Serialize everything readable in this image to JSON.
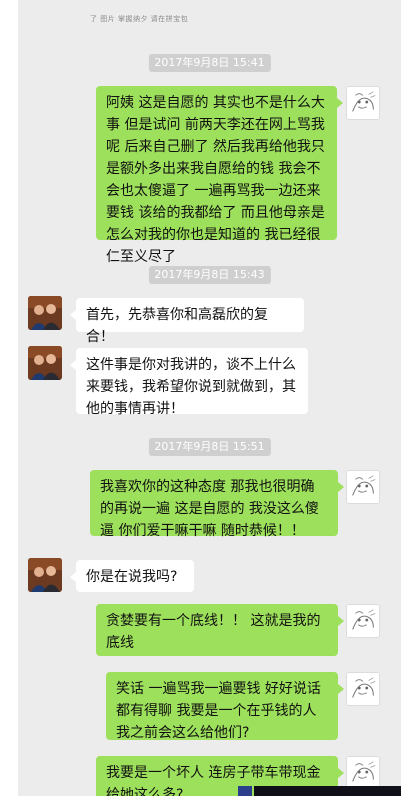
{
  "topbar": {
    "text": "了 图片 掌握纳夕 请在拼宝包"
  },
  "messages": [
    {
      "kind": "time",
      "text": "2017年9月8日 15:41"
    },
    {
      "kind": "msg",
      "side": "self",
      "text": "阿姨 这是自愿的 其实也不是什么大事 但是试问 前两天李还在网上骂我呢 后来自己删了 然后我再给他我只是额外多出来我自愿给的钱 我会不会也太傻逼了 一遍再骂我一边还来要钱 该给的我都给了 而且他母亲是怎么对我的你也是知道的 我已经很仁至义尽了"
    },
    {
      "kind": "time",
      "text": "2017年9月8日 15:43"
    },
    {
      "kind": "msg",
      "side": "other",
      "text": "首先，先恭喜你和高磊欣的复合！"
    },
    {
      "kind": "msg",
      "side": "other",
      "text": "这件事是你对我讲的，谈不上什么来要钱，我希望你说到就做到，其他的事情再讲！"
    },
    {
      "kind": "time",
      "text": "2017年9月8日 15:51"
    },
    {
      "kind": "msg",
      "side": "self",
      "text": "我喜欢你的这种态度 那我也很明确的再说一遍 这是自愿的 我没这么傻逼 你们爱干嘛干嘛 随时恭候！！"
    },
    {
      "kind": "msg",
      "side": "other",
      "text": "你是在说我吗?"
    },
    {
      "kind": "msg",
      "side": "self",
      "text": "贪婪要有一个底线！！ 这就是我的底线"
    },
    {
      "kind": "msg",
      "side": "self",
      "text": "笑话 一遍骂我一遍要钱 好好说话都有得聊 我要是一个在乎钱的人我之前会这么给他们?"
    },
    {
      "kind": "msg",
      "side": "self",
      "text": "我要是一个坏人 连房子带车带现金给她这么多?"
    }
  ]
}
